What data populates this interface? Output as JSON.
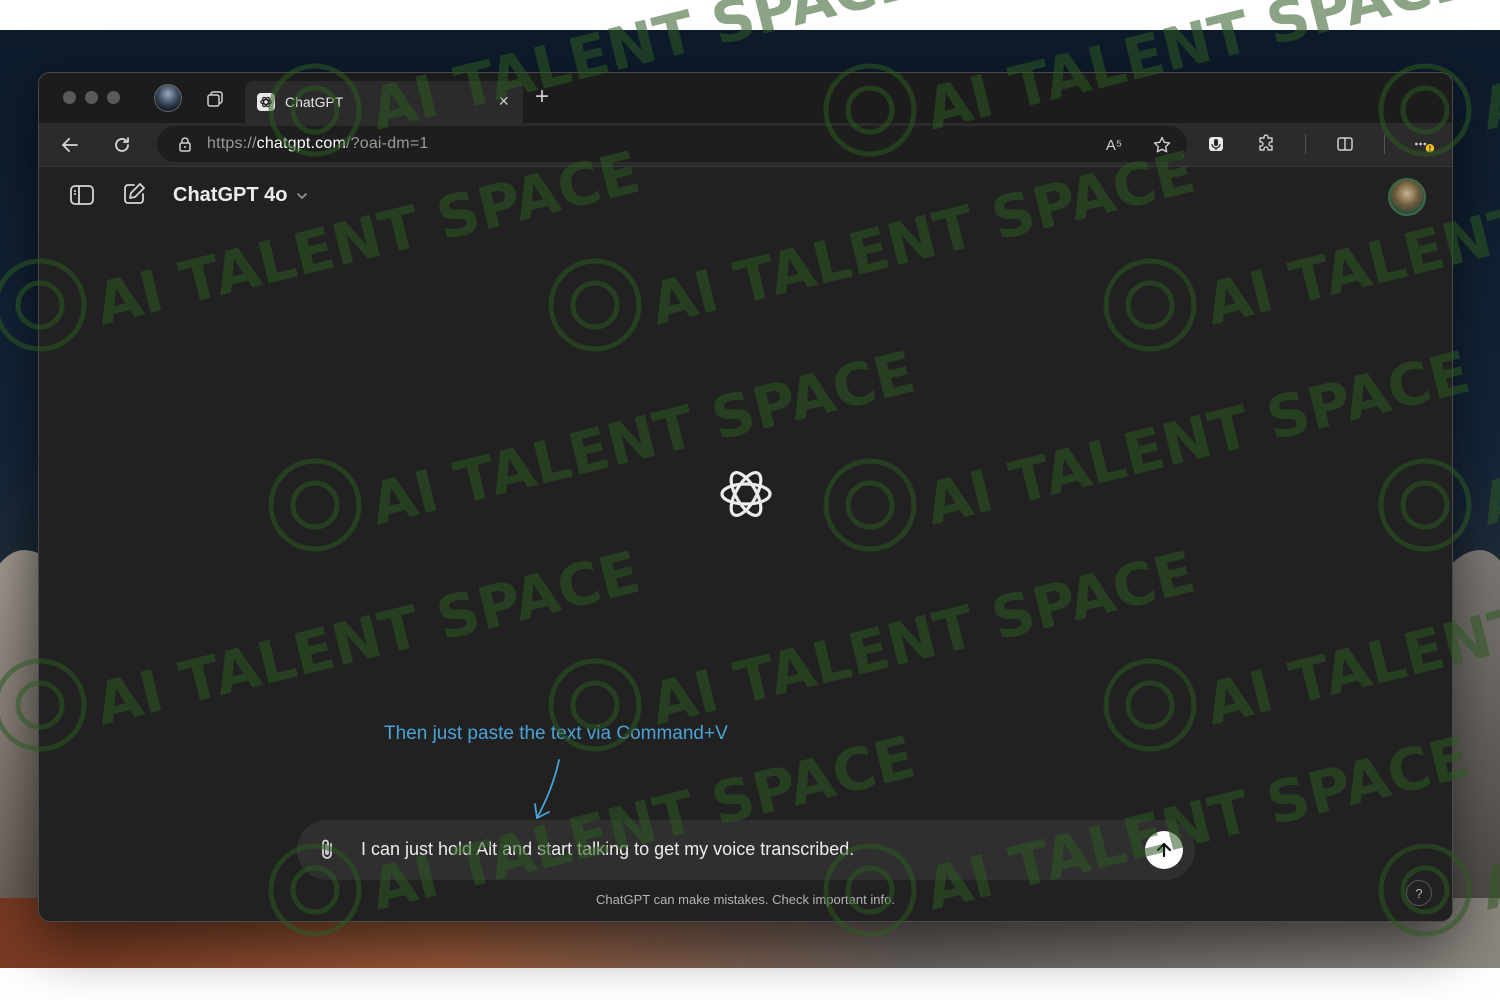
{
  "browser": {
    "tab": {
      "title": "ChatGPT",
      "close": "×"
    },
    "new_tab": "+",
    "url": {
      "scheme": "https://",
      "host": "chatgpt.com",
      "path": "/?oai-dm=1"
    },
    "read_aloud": "A⁵"
  },
  "app": {
    "model_name": "ChatGPT 4o",
    "annotation": "Then just paste the text via Command+V",
    "composer_text": "I can just hold Alt and start talking to get my voice transcribed.",
    "disclaimer": "ChatGPT can make mistakes. Check important info.",
    "help": "?"
  },
  "watermark": {
    "text": "AI TALENT SPACE",
    "color": "#2e5a24"
  },
  "colors": {
    "accent_annotation": "#4aa3d8",
    "app_bg": "#212121",
    "composer_bg": "#2f2f2f"
  },
  "icons": {
    "sidebar_toggle": "sidebar-icon",
    "new_chat": "edit-icon",
    "attach": "paperclip-icon",
    "send": "arrow-up-icon",
    "logo": "openai-logo-icon"
  }
}
